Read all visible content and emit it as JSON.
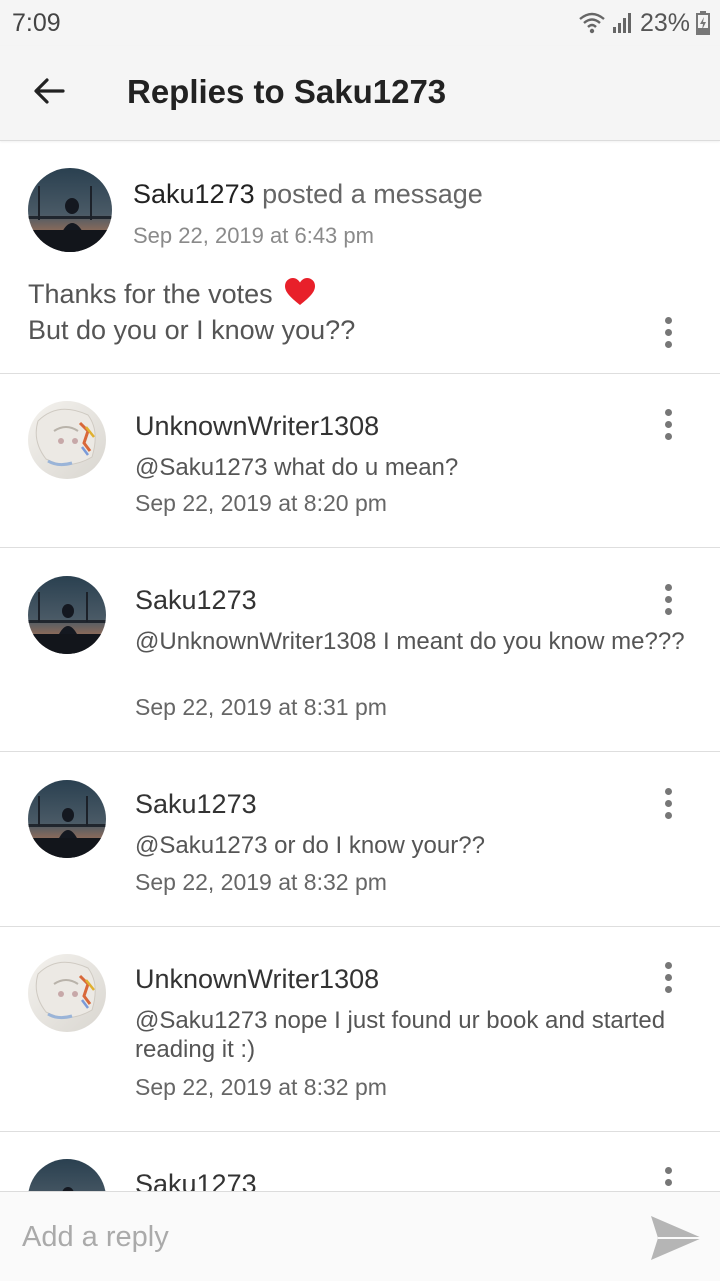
{
  "status": {
    "time": "7:09",
    "battery": "23%"
  },
  "header": {
    "title": "Replies to Saku1273"
  },
  "post": {
    "author": "Saku1273",
    "action": "posted a message",
    "time": "Sep 22, 2019 at 6:43 pm",
    "body_line1": "Thanks for the votes",
    "body_line2": "But do you or I know you??"
  },
  "replies": [
    {
      "name": "UnknownWriter1308",
      "text": "@Saku1273 what do u mean?",
      "time": "Sep 22, 2019 at 8:20 pm"
    },
    {
      "name": "Saku1273",
      "text": "@UnknownWriter1308 I meant do you know me???",
      "time": "Sep 22, 2019 at 8:31 pm"
    },
    {
      "name": "Saku1273",
      "text": "@Saku1273 or do I know your??",
      "time": "Sep 22, 2019 at 8:32 pm"
    },
    {
      "name": "UnknownWriter1308",
      "text": "@Saku1273 nope I just found ur book and started reading it :)",
      "time": "Sep 22, 2019 at 8:32 pm"
    },
    {
      "name": "Saku1273",
      "text": "",
      "time": ""
    }
  ],
  "composer": {
    "placeholder": "Add a reply"
  },
  "colors": {
    "accent_heart": "#e8202a",
    "muted_text": "#8a8a8a",
    "divider": "#dedede"
  },
  "icons": [
    "back-arrow-icon",
    "more-vert-icon",
    "send-icon",
    "wifi-icon",
    "signal-icon",
    "battery-icon",
    "heart-icon"
  ]
}
